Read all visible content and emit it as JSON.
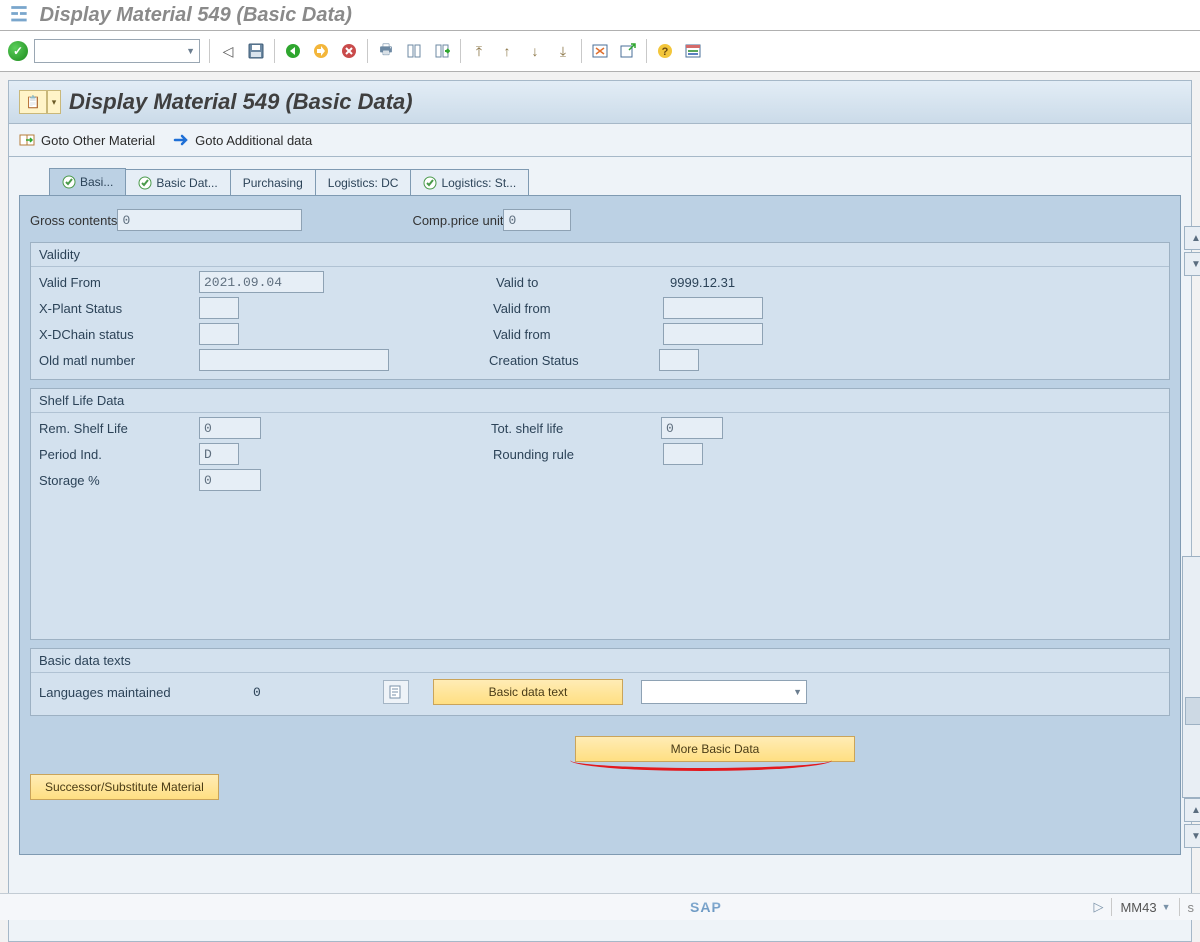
{
  "window_title": "Display Material 549 (Basic Data)",
  "app_title": "Display Material 549 (Basic Data)",
  "sub_toolbar": {
    "goto_other": "Goto Other Material",
    "goto_additional": "Goto Additional data"
  },
  "tabs": [
    "Basi...",
    "Basic Dat...",
    "Purchasing",
    "Logistics: DC",
    "Logistics: St..."
  ],
  "top_row": {
    "gross_contents_label": "Gross contents",
    "gross_contents_value": "0",
    "comp_price_label": "Comp.price unit",
    "comp_price_value": "0"
  },
  "validity": {
    "title": "Validity",
    "valid_from_label": "Valid From",
    "valid_from_value": "2021.09.04",
    "valid_to_label": "Valid to",
    "valid_to_value": "9999.12.31",
    "xplant_label": "X-Plant Status",
    "xplant_value": "",
    "xplant_valid_from_label": "Valid from",
    "xplant_valid_from_value": "",
    "xdchain_label": "X-DChain status",
    "xdchain_value": "",
    "xdchain_valid_from_label": "Valid from",
    "xdchain_valid_from_value": "",
    "oldmatl_label": "Old matl number",
    "oldmatl_value": "",
    "creation_status_label": "Creation Status",
    "creation_status_value": ""
  },
  "shelf": {
    "title": "Shelf Life Data",
    "rem_label": "Rem. Shelf Life",
    "rem_value": "0",
    "tot_label": "Tot. shelf life",
    "tot_value": "0",
    "period_label": "Period Ind.",
    "period_value": "D",
    "rounding_label": "Rounding rule",
    "rounding_value": "",
    "storage_label": "Storage %",
    "storage_value": "0"
  },
  "texts": {
    "title": "Basic data texts",
    "lang_label": "Languages maintained",
    "lang_value": "0",
    "basic_text_btn": "Basic data text"
  },
  "more_btn": "More Basic Data",
  "successor_btn": "Successor/Substitute Material",
  "status": {
    "tcode": "MM43"
  }
}
